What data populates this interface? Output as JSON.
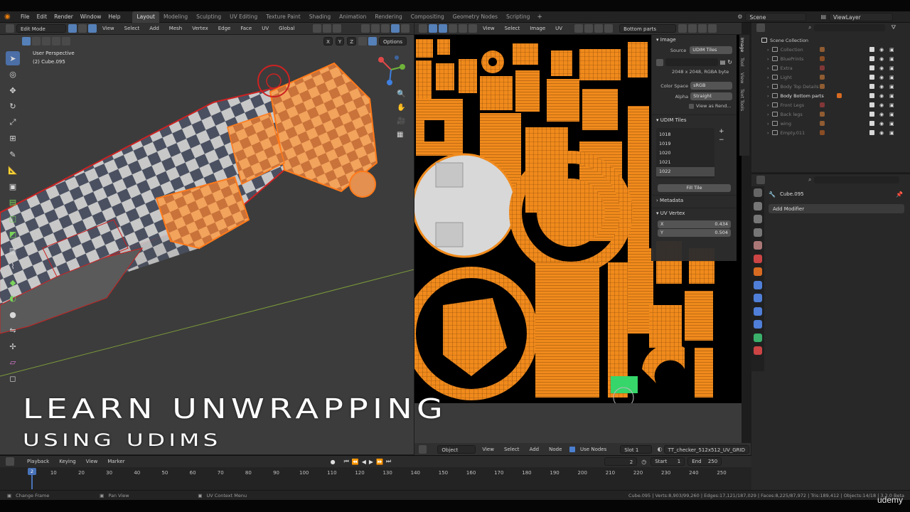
{
  "menubar": {
    "items": [
      "File",
      "Edit",
      "Render",
      "Window",
      "Help"
    ],
    "workspaces": [
      "Layout",
      "Modeling",
      "Sculpting",
      "UV Editing",
      "Texture Paint",
      "Shading",
      "Animation",
      "Rendering",
      "Compositing",
      "Geometry Nodes",
      "Scripting"
    ],
    "active_workspace": "Layout",
    "scene": "Scene",
    "view_layer": "ViewLayer"
  },
  "viewport": {
    "mode": "Edit Mode",
    "menus": [
      "View",
      "Select",
      "Add",
      "Mesh",
      "Vertex",
      "Edge",
      "Face",
      "UV"
    ],
    "transform": "Global",
    "axes": [
      "X",
      "Y",
      "Z"
    ],
    "options": "Options",
    "perspective": "User Perspective",
    "object": "(2) Cube.095"
  },
  "uv_editor": {
    "menus": [
      "View",
      "Select",
      "Image",
      "UV"
    ],
    "image_name": "Bottom parts"
  },
  "npanel": {
    "tabs": [
      "Image",
      "Tool",
      "View",
      "Text Tools"
    ],
    "image_section": "Image",
    "source_label": "Source",
    "source_value": "UDIM Tiles",
    "resolution": "2048 x 2048, RGBA byte",
    "color_space_label": "Color Space",
    "color_space_value": "sRGB",
    "alpha_label": "Alpha",
    "alpha_value": "Straight",
    "view_as_render": "View as Rend...",
    "udim_section": "UDIM Tiles",
    "tiles": [
      "1018",
      "1019",
      "1020",
      "1021",
      "1022"
    ],
    "selected_tile": "1022",
    "fill_tile": "Fill Tile",
    "metadata": "Metadata",
    "uv_vertex": "UV Vertex",
    "x_label": "X",
    "x_value": "0.434",
    "y_label": "Y",
    "y_value": "0.504"
  },
  "node_header": {
    "mode": "Object",
    "menus": [
      "View",
      "Select",
      "Add",
      "Node"
    ],
    "use_nodes": "Use Nodes",
    "slot": "Slot 1",
    "material": "TT_checker_512x512_UV_GRID"
  },
  "outliner": {
    "root": "Scene Collection",
    "items": [
      {
        "name": "Collection",
        "dim": true
      },
      {
        "name": "BluePrints",
        "dim": true
      },
      {
        "name": "Extra",
        "dim": true
      },
      {
        "name": "Light",
        "dim": true
      },
      {
        "name": "Body Top Details",
        "dim": true
      },
      {
        "name": "Body Bottom parts",
        "dim": false
      },
      {
        "name": "Front Legs",
        "dim": true
      },
      {
        "name": "Back legs",
        "dim": true
      },
      {
        "name": "wing",
        "dim": true
      },
      {
        "name": "Empty.011",
        "dim": true
      }
    ]
  },
  "properties": {
    "object": "Cube.095",
    "add_modifier": "Add Modifier"
  },
  "timeline": {
    "menus": [
      "Playback",
      "Keying",
      "View",
      "Marker"
    ],
    "current_frame": "2",
    "start_label": "Start",
    "start_value": "1",
    "end_label": "End",
    "end_value": "250",
    "ticks": [
      "10",
      "20",
      "30",
      "40",
      "50",
      "60",
      "70",
      "80",
      "90",
      "100",
      "110",
      "120",
      "130",
      "140",
      "150",
      "160",
      "170",
      "180",
      "190",
      "200",
      "210",
      "220",
      "230",
      "240",
      "250"
    ],
    "scrub_frame": "2"
  },
  "statusbar": {
    "left": "Change Frame",
    "middle": "Pan View",
    "right": "UV Context Menu",
    "stats": "Cube.095 | Verts:8,903/99,260 | Edges:17,121/187,029 | Faces:8,225/87,972 | Tris:189,412 | Objects:14/18 | 3.2.0 Beta"
  },
  "overlay": {
    "title": "LEARN UNWRAPPING",
    "subtitle": "USING UDIMS",
    "watermark": "udemy"
  },
  "colors": {
    "accent": "#4b6fa6",
    "uv_orange": "#f08a1c",
    "selected_island": "#d8d8d8"
  }
}
